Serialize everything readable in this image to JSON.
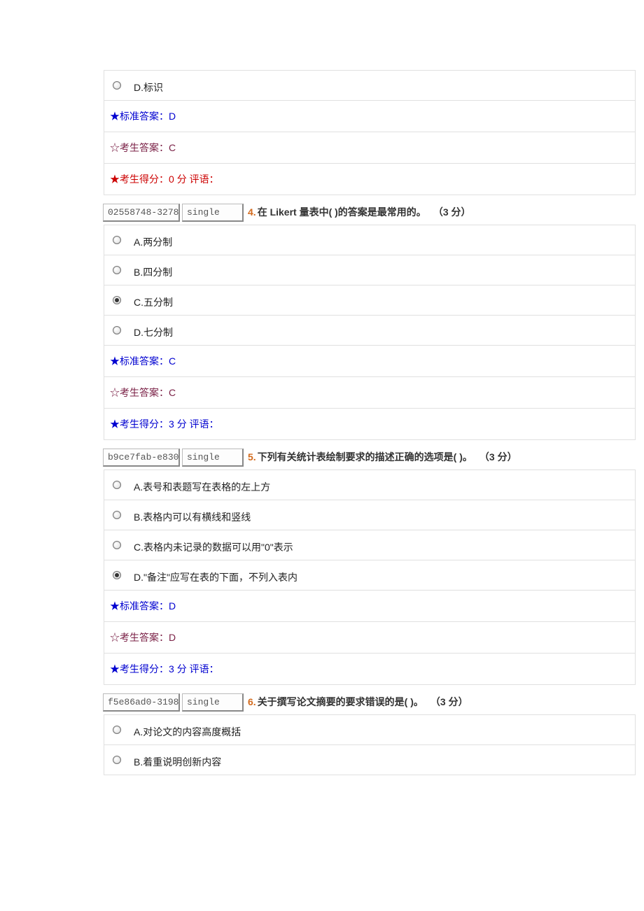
{
  "labels": {
    "std_prefix": "★标准答案：",
    "stu_prefix": "☆考生答案：",
    "score_prefix": "★考生得分：",
    "score_unit": "分",
    "comment_label": "  评语：",
    "points_open": "（",
    "points_close": " 分）"
  },
  "remainder_q3": {
    "option_d": "D.标识",
    "std_answer": "D",
    "stu_answer": "C",
    "score": "0",
    "comment": "",
    "correct": false
  },
  "q4": {
    "id_box": "02558748-3278-",
    "type_box": "single",
    "number": "4.",
    "text": "在 Likert 量表中( )的答案是最常用的。",
    "points": "3",
    "options": [
      {
        "label": "A.两分制",
        "selected": false
      },
      {
        "label": "B.四分制",
        "selected": false
      },
      {
        "label": "C.五分制",
        "selected": true
      },
      {
        "label": "D.七分制",
        "selected": false
      }
    ],
    "std_answer": "C",
    "stu_answer": "C",
    "score": "3",
    "comment": "",
    "correct": true
  },
  "q5": {
    "id_box": "b9ce7fab-e830-",
    "type_box": "single",
    "number": "5.",
    "text": "下列有关统计表绘制要求的描述正确的选项是( )。",
    "points": "3",
    "options": [
      {
        "label": "A.表号和表题写在表格的左上方",
        "selected": false
      },
      {
        "label": "B.表格内可以有横线和竖线",
        "selected": false
      },
      {
        "label": "C.表格内未记录的数据可以用\"0\"表示",
        "selected": false
      },
      {
        "label": "D.\"备注\"应写在表的下面，不列入表内",
        "selected": true
      }
    ],
    "std_answer": "D",
    "stu_answer": "D",
    "score": "3",
    "comment": "",
    "correct": true
  },
  "q6": {
    "id_box": "f5e86ad0-3198-",
    "type_box": "single",
    "number": "6.",
    "text": "关于撰写论文摘要的要求错误的是( )。",
    "points": "3",
    "options_partial": [
      {
        "label": "A.对论文的内容高度概括",
        "selected": false
      },
      {
        "label": "B.着重说明创新内容",
        "selected": false
      }
    ]
  }
}
